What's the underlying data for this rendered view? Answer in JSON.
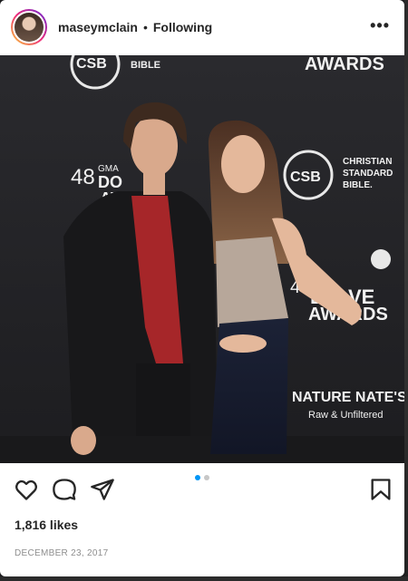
{
  "header": {
    "username": "maseymclain",
    "separator": "•",
    "following_label": "Following",
    "more_label": "•••"
  },
  "photo": {
    "backdrop_texts": {
      "top_csb": "CSB",
      "top_bible": "BIBLE",
      "top_awards": "AWARDS",
      "gma_48": "48",
      "gma": "GMA",
      "gma_do": "DO",
      "gma_aw": "AW",
      "csb": "CSB",
      "christian": "CHRISTIAN",
      "standard": "STANDARD",
      "bible": "BIBLE.",
      "right_48": "48",
      "right_dove": "D",
      "right_dove2": "VE",
      "right_awards": "AWARDS",
      "nature_nates": "NATURE NATE'S",
      "raw_unfiltered": "Raw & Unfiltered"
    }
  },
  "carousel": {
    "count": 2,
    "active_index": 0
  },
  "actions": {
    "like_icon": "heart-icon",
    "comment_icon": "comment-icon",
    "share_icon": "share-icon",
    "save_icon": "bookmark-icon"
  },
  "likes": "1,816 likes",
  "date": "DECEMBER 23, 2017",
  "colors": {
    "accent": "#0095f6",
    "text": "#262626",
    "muted": "#8e8e8e"
  }
}
